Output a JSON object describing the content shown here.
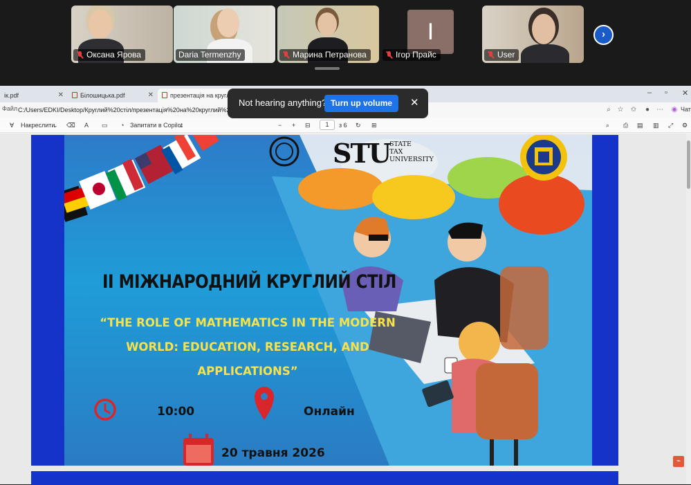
{
  "participants": [
    {
      "name": "Оксана Ярова",
      "muted": true
    },
    {
      "name": "Daria Termenzhy",
      "muted": false,
      "speaking": true
    },
    {
      "name": "Марина Петранова",
      "muted": true
    },
    {
      "name": "Ігор Прайс",
      "muted": true,
      "avatar_letter": "І"
    },
    {
      "name": "User",
      "muted": true
    }
  ],
  "browser": {
    "tabs": [
      {
        "label": "ік.pdf"
      },
      {
        "label": "Білошицька.pdf"
      },
      {
        "label": "презентація на круглий стіл.pdf",
        "active": true
      }
    ],
    "file_label": "Файл",
    "url": "C:/Users/EDKI/Desktop/Круглий%20стіл/презентація%20на%20круглий%20стіл.pdf",
    "chat_label": "Чат"
  },
  "toast": {
    "message": "Not hearing anything?",
    "action": "Turn up volume"
  },
  "pdf_toolbar": {
    "draw_label": "Накреслити",
    "copilot_label": "Запитати в Copilot",
    "page_current": "1",
    "page_total": "з 6"
  },
  "slide": {
    "logo_text": "STU",
    "logo_sub": [
      "STATE",
      "TAX",
      "UNIVERSITY"
    ],
    "heading": "II МІЖНАРОДНИЙ КРУГЛИЙ СТІЛ",
    "title": "“THE ROLE OF MATHEMATICS IN THE MODERN WORLD: EDUCATION, RESEARCH, AND APPLICATIONS”",
    "time": "10:00",
    "place": "Онлайн",
    "date": "20 травня 2026",
    "colors": {
      "frame": "#1633c9",
      "title": "#f7e24a",
      "icon_red": "#d9262b"
    }
  }
}
